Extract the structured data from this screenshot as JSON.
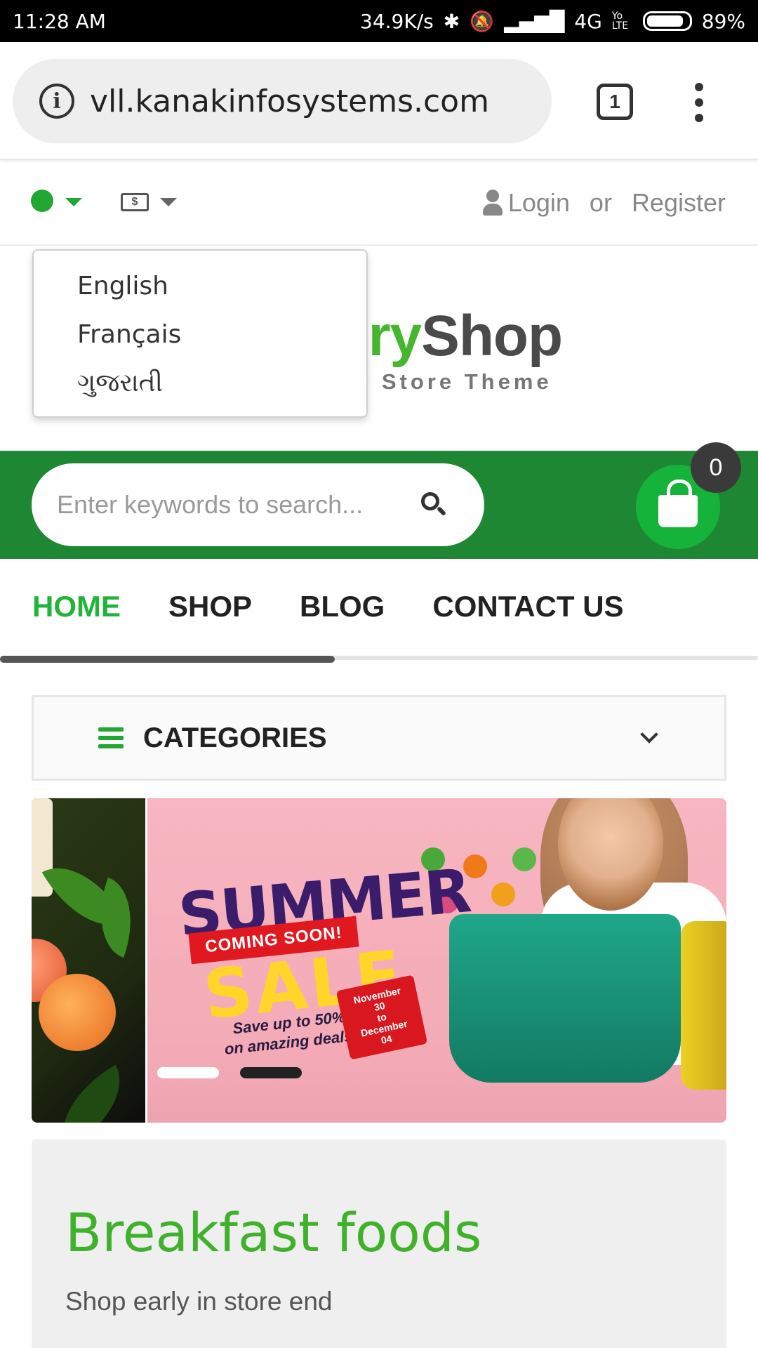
{
  "status_bar": {
    "time": "11:28 AM",
    "speed": "34.9K/s",
    "network": "4G",
    "volte": "Yo LTE",
    "battery": "89%",
    "battery_level": 0.89
  },
  "browser": {
    "url": "vll.kanakinfosystems.com",
    "tab_count": "1"
  },
  "topbar": {
    "login": "Login",
    "or": "or",
    "register": "Register"
  },
  "language_menu": {
    "items": [
      "English",
      "Français",
      "ગુજરાતી"
    ]
  },
  "logo": {
    "part_green": "ery",
    "part_dark": "Shop",
    "tagline": "e Store Theme"
  },
  "search": {
    "placeholder": "Enter keywords to search..."
  },
  "cart": {
    "count": "0"
  },
  "nav": {
    "items": [
      "HOME",
      "SHOP",
      "BLOG",
      "CONTACT US"
    ],
    "active": "HOME"
  },
  "categories": {
    "label": "CATEGORIES"
  },
  "banner": {
    "headline": "SUMMER",
    "ribbon": "COMING SOON!",
    "sale": "SALE",
    "deal_line1": "Save up to 50%",
    "deal_line2": "on amazing deals!",
    "date_line1": "November 30",
    "date_line2": "to",
    "date_line3": "December 04",
    "slide_count": 2,
    "active_slide": 1
  },
  "promo": {
    "title": "Breakfast foods",
    "subtitle": "Shop early in store end"
  },
  "colors": {
    "brand_green": "#1e8734",
    "accent_green": "#22b33a",
    "cart_green": "#16b33a",
    "banner_pink": "#f5b1bd"
  }
}
